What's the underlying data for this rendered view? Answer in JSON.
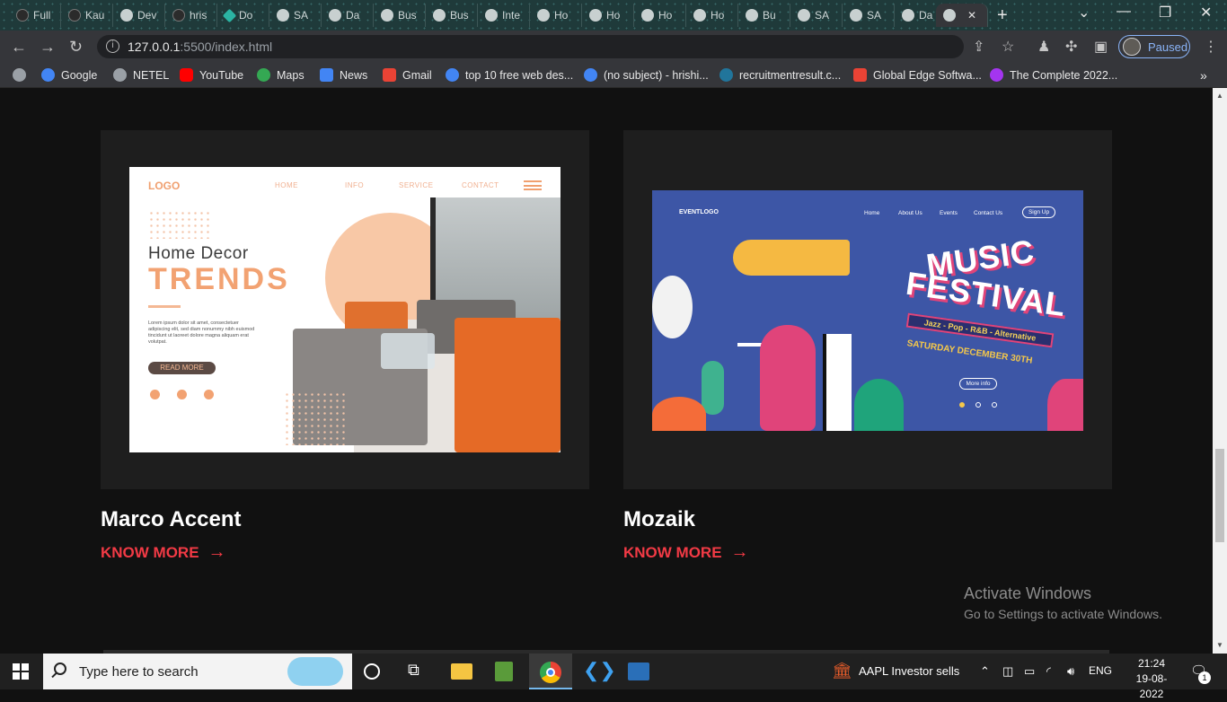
{
  "browser": {
    "tabs": [
      {
        "label": "Full",
        "icon": "github-icon"
      },
      {
        "label": "Kau",
        "icon": "github-icon"
      },
      {
        "label": "Dev",
        "icon": "globe-icon"
      },
      {
        "label": "hris",
        "icon": "github-icon"
      },
      {
        "label": "Do",
        "icon": "diamond-icon"
      },
      {
        "label": "SA",
        "icon": "globe-icon"
      },
      {
        "label": "Da",
        "icon": "globe-icon"
      },
      {
        "label": "Bus",
        "icon": "globe-icon"
      },
      {
        "label": "Bus",
        "icon": "globe-icon"
      },
      {
        "label": "Inte",
        "icon": "globe-icon"
      },
      {
        "label": "Ho",
        "icon": "globe-icon"
      },
      {
        "label": "Ho",
        "icon": "globe-icon"
      },
      {
        "label": "Ho",
        "icon": "globe-icon"
      },
      {
        "label": "Ho",
        "icon": "globe-icon"
      },
      {
        "label": "Bu",
        "icon": "globe-icon"
      },
      {
        "label": "SA",
        "icon": "globe-icon"
      },
      {
        "label": "SA",
        "icon": "globe-icon"
      },
      {
        "label": "Da",
        "icon": "globe-icon"
      }
    ],
    "url_host": "127.0.0.1",
    "url_rest": ":5500/index.html",
    "profile_status": "Paused",
    "bookmarks": [
      {
        "label": "Google",
        "color": "#4285f4"
      },
      {
        "label": "NETEL",
        "color": "#9aa0a6"
      },
      {
        "label": "YouTube",
        "color": "#ff0000"
      },
      {
        "label": "Maps",
        "color": "#34a853"
      },
      {
        "label": "News",
        "color": "#4285f4"
      },
      {
        "label": "Gmail",
        "color": "#ea4335"
      },
      {
        "label": "top 10 free web des...",
        "color": "#4285f4"
      },
      {
        "label": "(no subject) - hrishi...",
        "color": "#4285f4"
      },
      {
        "label": "recruitmentresult.c...",
        "color": "#21759b"
      },
      {
        "label": "Global Edge Softwa...",
        "color": "#ea4335"
      },
      {
        "label": "The Complete 2022...",
        "color": "#a435f0"
      }
    ]
  },
  "projects": [
    {
      "title": "Marco Accent",
      "cta": "KNOW MORE",
      "thumb": {
        "logo": "LOGO",
        "nav": [
          "HOME",
          "INFO",
          "SERVICE",
          "CONTACT"
        ],
        "heading1": "Home  Decor",
        "heading2": "TRENDS",
        "body": "Lorem ipsum dolor sit amet, consectetuer adipiscing elit, sed diam nonummy nibh euismod tincidunt ut laoreet dolore magna aliquam erat volutpat.",
        "button": "READ MORE"
      }
    },
    {
      "title": "Mozaik",
      "cta": "KNOW MORE",
      "thumb": {
        "logo": "EVENTLOGO",
        "nav": [
          "Home",
          "About Us",
          "Events",
          "Contact Us"
        ],
        "signup": "Sign Up",
        "line1": "MUSIC",
        "line2": "FESTIVAL",
        "genres": "Jazz - Pop - R&B - Alternative",
        "date": "SATURDAY DECEMBER 30TH",
        "button": "More info"
      }
    }
  ],
  "watermark": {
    "title": "Activate Windows",
    "subtitle": "Go to Settings to activate Windows."
  },
  "taskbar": {
    "search_placeholder": "Type here to search",
    "stock_text": "AAPL  Investor sells",
    "language": "ENG",
    "time": "21:24",
    "date": "19-08-2022",
    "notification_count": "1"
  },
  "colors": {
    "accent": "#f23a45",
    "card_bg": "#1e1e1e",
    "page_bg": "#111111"
  }
}
